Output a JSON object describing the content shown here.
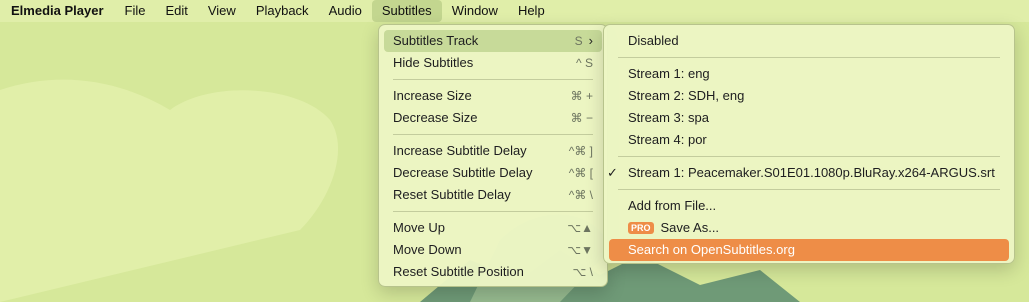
{
  "menubar": {
    "app": "Elmedia Player",
    "items": [
      "File",
      "Edit",
      "View",
      "Playback",
      "Audio",
      "Subtitles",
      "Window",
      "Help"
    ]
  },
  "subtitles_menu": {
    "track": {
      "label": "Subtitles Track",
      "shortcut": "S"
    },
    "hide": {
      "label": "Hide Subtitles",
      "shortcut": "^ S"
    },
    "increase_size": {
      "label": "Increase Size",
      "shortcut": "⌘ +"
    },
    "decrease_size": {
      "label": "Decrease Size",
      "shortcut": "⌘ −"
    },
    "increase_delay": {
      "label": "Increase Subtitle Delay",
      "shortcut": "^⌘ ]"
    },
    "decrease_delay": {
      "label": "Decrease Subtitle Delay",
      "shortcut": "^⌘ ["
    },
    "reset_delay": {
      "label": "Reset Subtitle Delay",
      "shortcut": "^⌘ \\"
    },
    "move_up": {
      "label": "Move Up",
      "shortcut": "⌥▲"
    },
    "move_down": {
      "label": "Move Down",
      "shortcut": "⌥▼"
    },
    "reset_position": {
      "label": "Reset Subtitle Position",
      "shortcut": "⌥ \\"
    }
  },
  "track_submenu": {
    "disabled": "Disabled",
    "streams": [
      "Stream 1: eng",
      "Stream 2: SDH, eng",
      "Stream 3: spa",
      "Stream 4: por"
    ],
    "external": "Stream 1: Peacemaker.S01E01.1080p.BluRay.x264-ARGUS.srt",
    "external_checked": true,
    "add_from_file": "Add from File...",
    "pro_badge": "PRO",
    "save_as": "Save As...",
    "search": "Search on OpenSubtitles.org"
  },
  "colors": {
    "accent": "#ee8d47",
    "background": "#d9e89c"
  }
}
